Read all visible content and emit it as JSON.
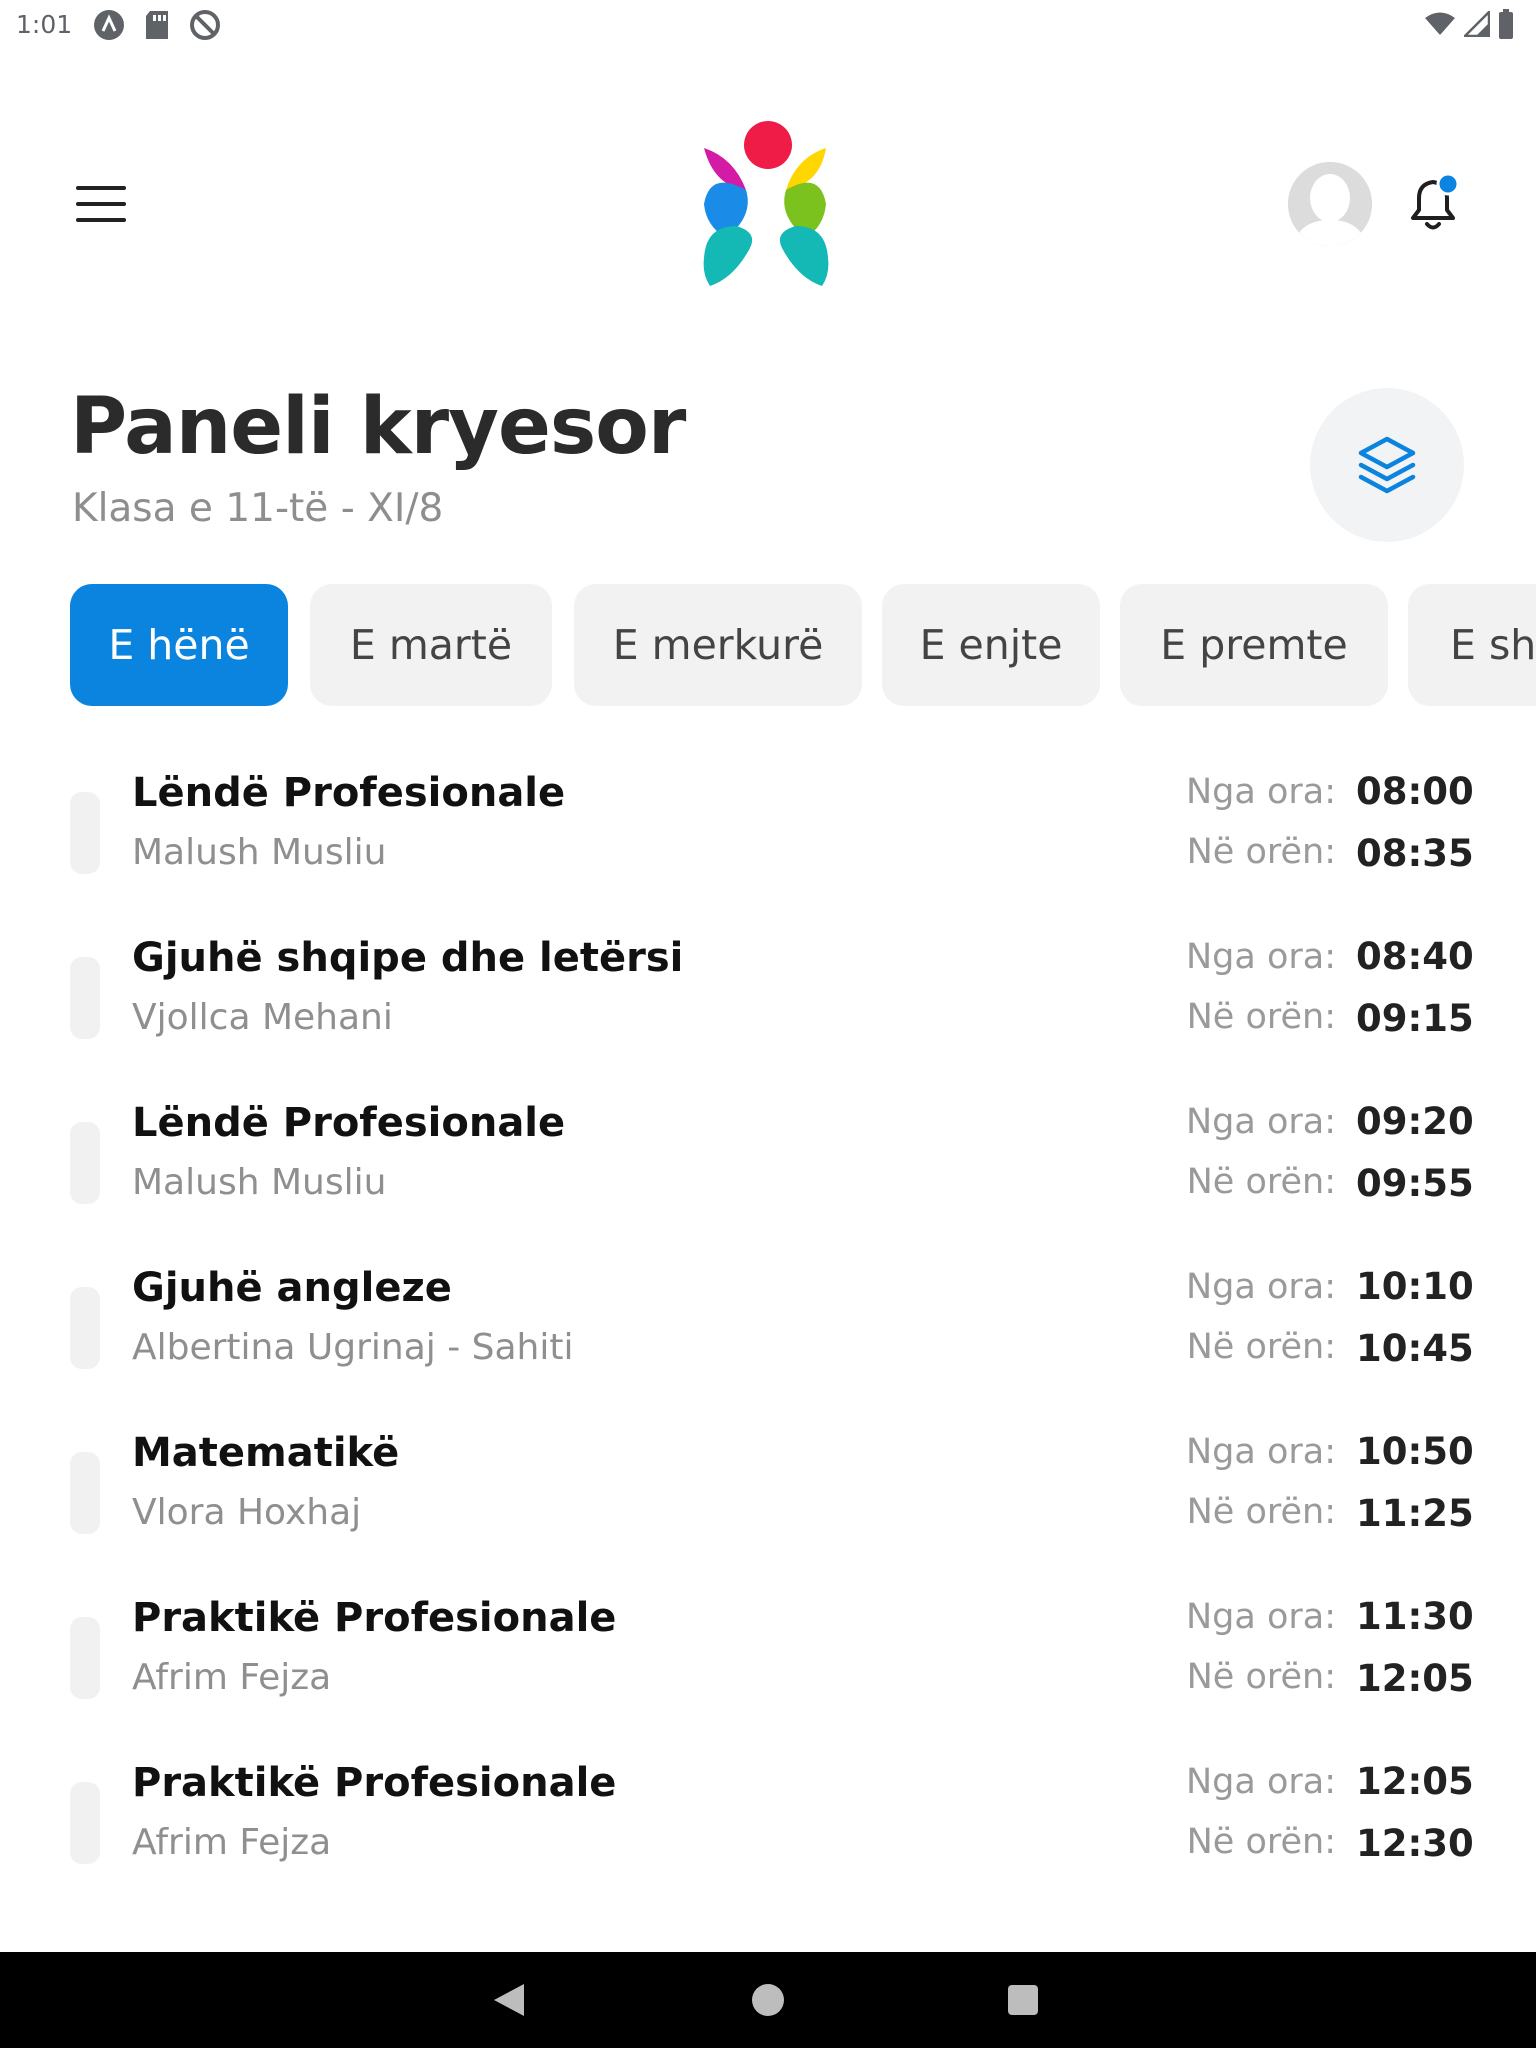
{
  "status_bar": {
    "time": "1:01"
  },
  "header": {
    "menu_icon": "hamburger-menu-icon",
    "logo_icon": "app-logo-icon",
    "avatar_icon": "user-avatar-icon",
    "bell_icon": "notification-bell-icon"
  },
  "page": {
    "title": "Paneli kryesor",
    "subtitle": "Klasa e 11-të - XI/8",
    "layers_icon": "layers-icon"
  },
  "tabs": [
    {
      "label": "E hënë",
      "active": true
    },
    {
      "label": "E martë",
      "active": false
    },
    {
      "label": "E merkurë",
      "active": false
    },
    {
      "label": "E enjte",
      "active": false
    },
    {
      "label": "E premte",
      "active": false
    },
    {
      "label": "E sht",
      "active": false
    }
  ],
  "schedule": {
    "from_label": "Nga ora:",
    "to_label": "Në orën:",
    "items": [
      {
        "subject": "Lëndë Profesionale",
        "teacher": "Malush Musliu",
        "from": "08:00",
        "to": "08:35"
      },
      {
        "subject": "Gjuhë shqipe dhe letërsi",
        "teacher": "Vjollca Mehani",
        "from": "08:40",
        "to": "09:15"
      },
      {
        "subject": "Lëndë Profesionale",
        "teacher": "Malush Musliu",
        "from": "09:20",
        "to": "09:55"
      },
      {
        "subject": "Gjuhë angleze",
        "teacher": "Albertina Ugrinaj - Sahiti",
        "from": "10:10",
        "to": "10:45"
      },
      {
        "subject": "Matematikë",
        "teacher": "Vlora Hoxhaj",
        "from": "10:50",
        "to": "11:25"
      },
      {
        "subject": "Praktikë Profesionale",
        "teacher": "Afrim Fejza",
        "from": "11:30",
        "to": "12:05"
      },
      {
        "subject": "Praktikë Profesionale",
        "teacher": "Afrim Fejza",
        "from": "12:05",
        "to": "12:30"
      }
    ]
  },
  "colors": {
    "accent": "#0b84e0",
    "title": "#2b2b2b",
    "muted": "#8e8e8e",
    "notification_dot": "#0b84e0"
  }
}
